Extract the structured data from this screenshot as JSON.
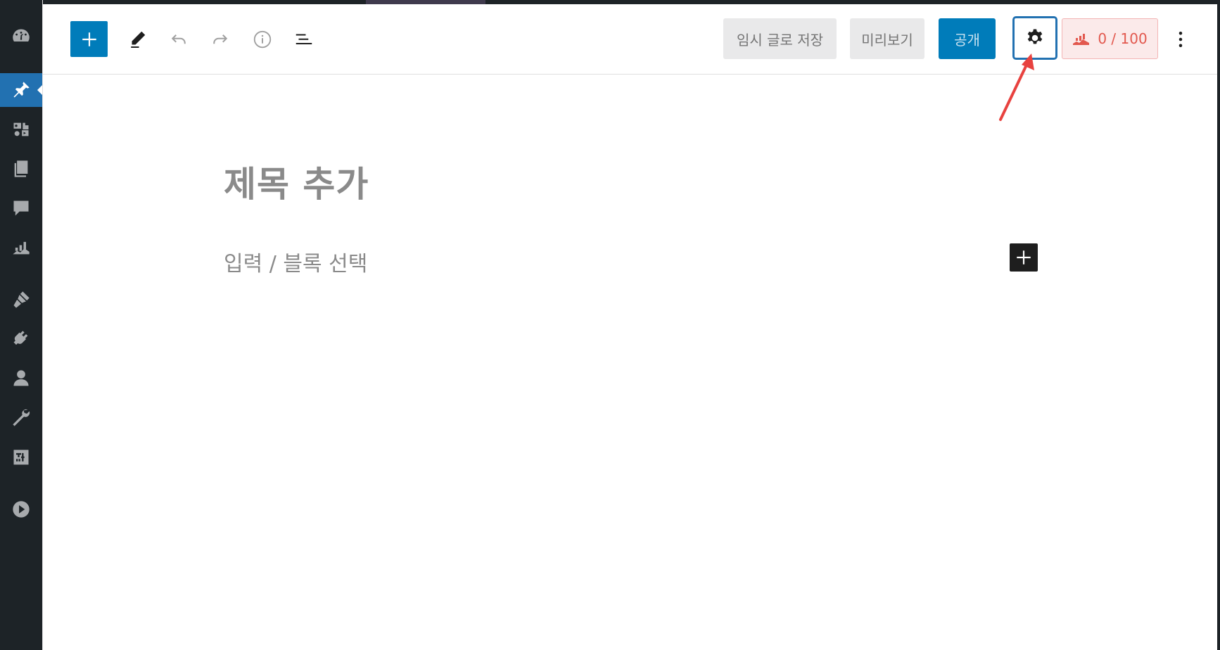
{
  "header": {
    "save_draft_label": "임시 글로 저장",
    "preview_label": "미리보기",
    "publish_label": "공개",
    "seo_score": "0 / 100"
  },
  "editor": {
    "title_placeholder": "제목 추가",
    "block_placeholder": "입력 / 블록 선택"
  },
  "sidebar": {
    "items": [
      {
        "icon": "dashboard-icon"
      },
      {
        "icon": "pin-icon",
        "active": true
      },
      {
        "icon": "media-icon"
      },
      {
        "icon": "pages-icon"
      },
      {
        "icon": "comments-icon"
      },
      {
        "icon": "analytics-icon"
      },
      {
        "icon": "appearance-icon"
      },
      {
        "icon": "plugins-icon"
      },
      {
        "icon": "users-icon"
      },
      {
        "icon": "tools-icon"
      },
      {
        "icon": "settings-icon"
      },
      {
        "icon": "play-icon"
      }
    ]
  },
  "colors": {
    "admin_bar": "#1d2327",
    "accent_blue": "#007cba",
    "settings_outline": "#2271b1",
    "seo_red": "#e2584e",
    "annotation_arrow": "#e8423f"
  }
}
